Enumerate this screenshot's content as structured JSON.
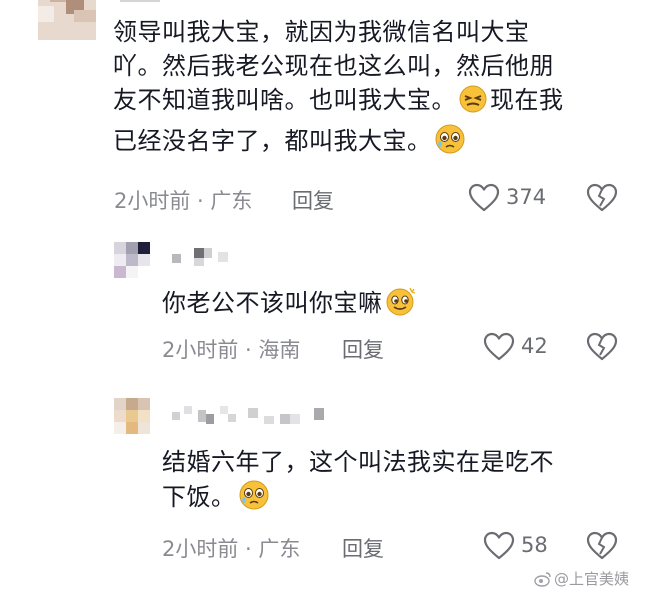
{
  "comments": [
    {
      "text_parts": [
        "领导叫我大宝，就因为我微信名叫大宝吖。然后我老公现在也这么叫，然后他朋友不知道我叫啥。也叫我大宝。",
        "现在我已经没名字了，都叫我大宝。",
        ""
      ],
      "line1": "领导叫我大宝，就因为我微信名叫大宝",
      "line2": "吖。然后我老公现在也这么叫，然后他朋",
      "line3a": "友不知道我叫啥。也叫我大宝。",
      "line3b": "现在我",
      "line4": "已经没名字了，都叫我大宝。",
      "time": "2小时前 · 广东",
      "reply": "回复",
      "likes": "374"
    },
    {
      "line1": "你老公不该叫你宝嘛",
      "time": "2小时前 · 海南",
      "reply": "回复",
      "likes": "42"
    },
    {
      "line1": "结婚六年了，这个叫法我实在是吃不",
      "line2": "下饭。",
      "time": "2小时前 · 广东",
      "reply": "回复",
      "likes": "58"
    }
  ],
  "watermark": "@上官美姨",
  "colors": {
    "heart": "#6b6c72",
    "meta": "#8a8b91"
  }
}
